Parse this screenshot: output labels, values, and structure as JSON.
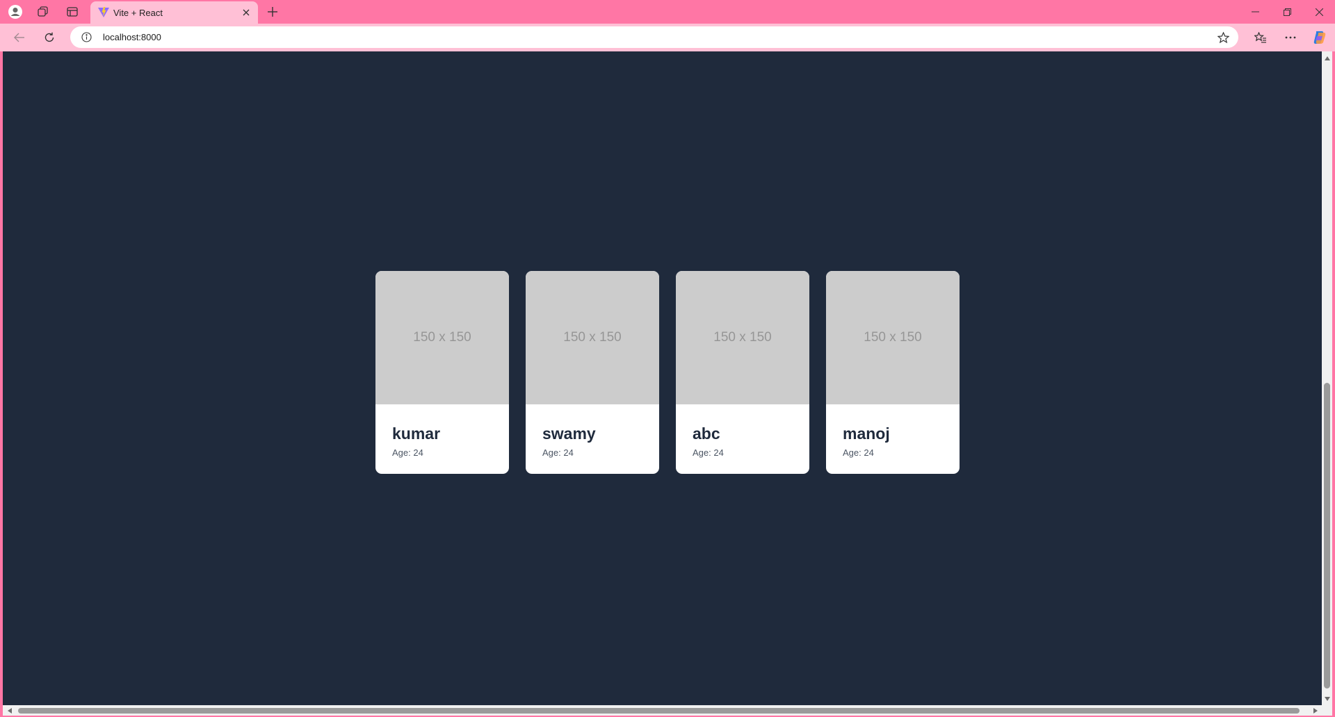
{
  "browser": {
    "tab": {
      "title": "Vite + React"
    },
    "address_bar": {
      "url": "localhost:8000"
    },
    "colors": {
      "frame": "#ff76a5",
      "toolbar": "#ffc0d6",
      "viewport_bg": "#1f2a3c"
    }
  },
  "page": {
    "cards": [
      {
        "image_placeholder": "150 x 150",
        "name": "kumar",
        "age": "Age: 24"
      },
      {
        "image_placeholder": "150 x 150",
        "name": "swamy",
        "age": "Age: 24"
      },
      {
        "image_placeholder": "150 x 150",
        "name": "abc",
        "age": "Age: 24"
      },
      {
        "image_placeholder": "150 x 150",
        "name": "manoj",
        "age": "Age: 24"
      }
    ]
  }
}
